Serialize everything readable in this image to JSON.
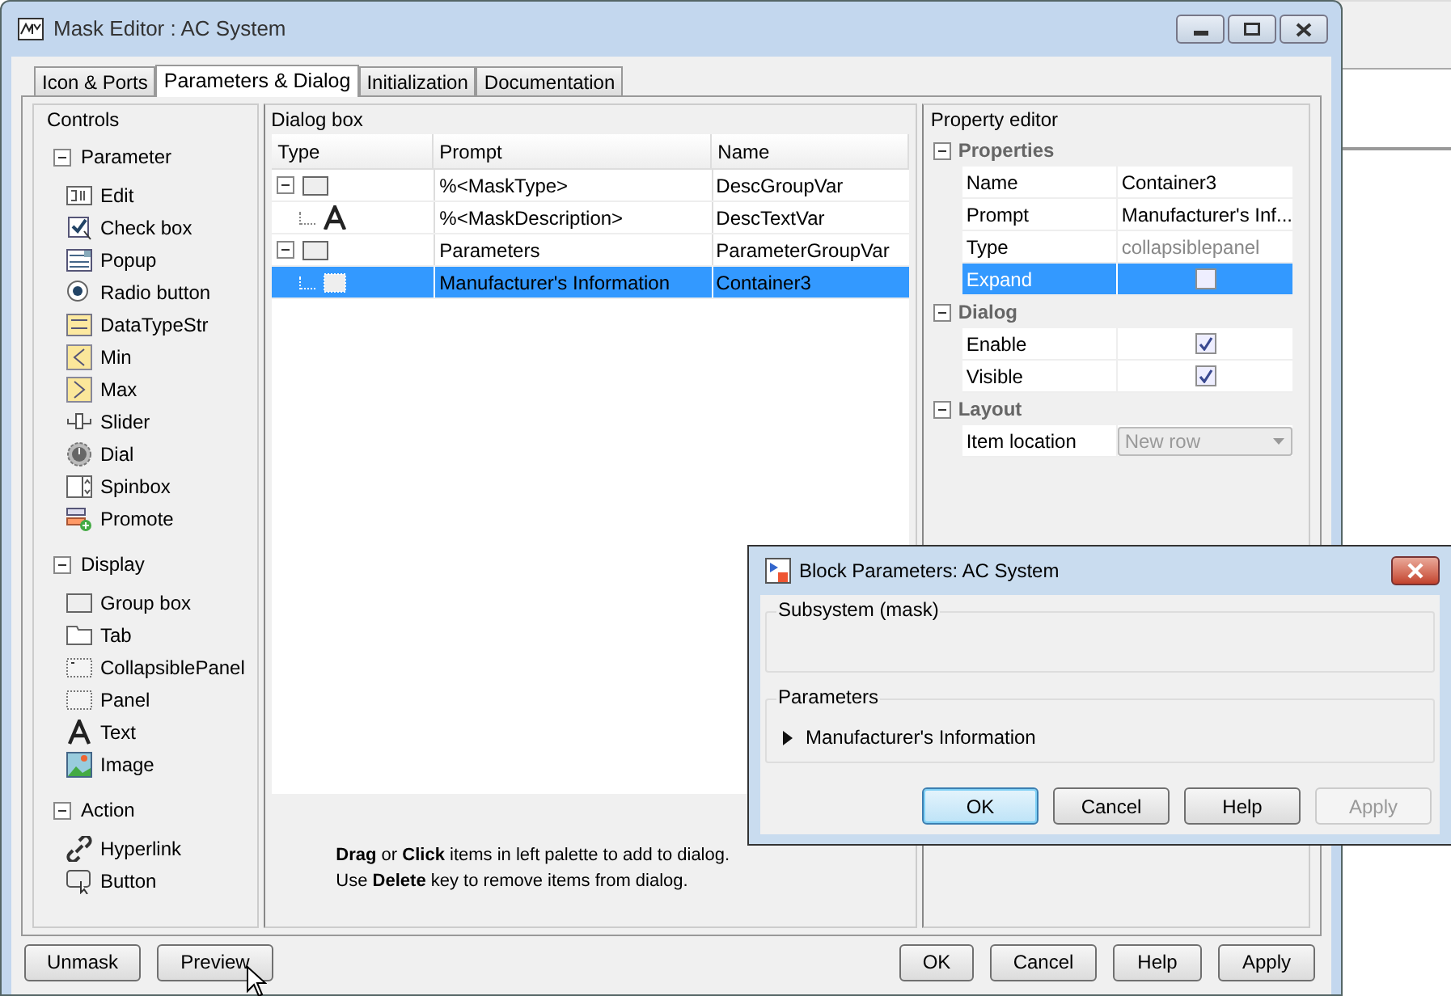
{
  "window": {
    "title": "Mask Editor : AC System"
  },
  "tabs": [
    {
      "label": "Icon & Ports",
      "selected": false
    },
    {
      "label": "Parameters & Dialog",
      "selected": true
    },
    {
      "label": "Initialization",
      "selected": false
    },
    {
      "label": "Documentation",
      "selected": false
    }
  ],
  "controls_palette": {
    "title": "Controls",
    "sections": [
      {
        "label": "Parameter",
        "expanded": true,
        "items": [
          {
            "label": "Edit",
            "kind": "edit"
          },
          {
            "label": "Check box",
            "kind": "checkbox"
          },
          {
            "label": "Popup",
            "kind": "popup"
          },
          {
            "label": "Radio button",
            "kind": "radio"
          },
          {
            "label": "DataTypeStr",
            "kind": "datatype"
          },
          {
            "label": "Min",
            "kind": "min"
          },
          {
            "label": "Max",
            "kind": "max"
          },
          {
            "label": "Slider",
            "kind": "slider"
          },
          {
            "label": "Dial",
            "kind": "dial"
          },
          {
            "label": "Spinbox",
            "kind": "spinbox"
          },
          {
            "label": "Promote",
            "kind": "promote"
          }
        ]
      },
      {
        "label": "Display",
        "expanded": true,
        "items": [
          {
            "label": "Group box",
            "kind": "groupbox"
          },
          {
            "label": "Tab",
            "kind": "tab"
          },
          {
            "label": "CollapsiblePanel",
            "kind": "collapsible"
          },
          {
            "label": "Panel",
            "kind": "panel"
          },
          {
            "label": "Text",
            "kind": "text"
          },
          {
            "label": "Image",
            "kind": "image"
          }
        ]
      },
      {
        "label": "Action",
        "expanded": true,
        "items": [
          {
            "label": "Hyperlink",
            "kind": "hyperlink"
          },
          {
            "label": "Button",
            "kind": "button"
          }
        ]
      }
    ]
  },
  "dialog_box": {
    "title": "Dialog box",
    "columns": [
      "Type",
      "Prompt",
      "Name"
    ],
    "rows": [
      {
        "kind": "group",
        "expanded": true,
        "prompt": "%<MaskType>",
        "name": "DescGroupVar",
        "selected": false,
        "children": [
          {
            "kind": "text",
            "prompt": "%<MaskDescription>",
            "name": "DescTextVar",
            "selected": false
          }
        ]
      },
      {
        "kind": "group",
        "expanded": true,
        "prompt": "Parameters",
        "name": "ParameterGroupVar",
        "selected": false,
        "children": [
          {
            "kind": "collapsible",
            "prompt": "Manufacturer's Information",
            "name": "Container3",
            "selected": true
          }
        ]
      }
    ],
    "hint_lines": [
      "**Drag** or **Click** items in left palette to add to dialog.",
      "Use **Delete** key to remove items from dialog."
    ]
  },
  "property_editor": {
    "title": "Property editor",
    "sections": [
      {
        "label": "Properties",
        "expanded": true,
        "rows": [
          {
            "kind": "text",
            "label": "Name",
            "value": "Container3",
            "disabled": false,
            "selected": false
          },
          {
            "kind": "text",
            "label": "Prompt",
            "value": "Manufacturer's Inf...",
            "disabled": false,
            "selected": false
          },
          {
            "kind": "text",
            "label": "Type",
            "value": "collapsiblepanel",
            "disabled": true,
            "selected": false
          },
          {
            "kind": "checkbox",
            "label": "Expand",
            "checked": false,
            "selected": true
          }
        ]
      },
      {
        "label": "Dialog",
        "expanded": true,
        "rows": [
          {
            "kind": "checkbox",
            "label": "Enable",
            "checked": true,
            "selected": false
          },
          {
            "kind": "checkbox",
            "label": "Visible",
            "checked": true,
            "selected": false
          }
        ]
      },
      {
        "label": "Layout",
        "expanded": true,
        "rows": [
          {
            "kind": "dropdown",
            "label": "Item location",
            "value": "New row",
            "disabled": true,
            "selected": false
          }
        ]
      }
    ]
  },
  "bottom_buttons_left": [
    "Unmask",
    "Preview"
  ],
  "bottom_buttons_right": [
    "OK",
    "Cancel",
    "Help",
    "Apply"
  ],
  "block_parameters": {
    "title": "Block Parameters: AC System",
    "subsystem_label": "Subsystem (mask)",
    "parameters_label": "Parameters",
    "panel": {
      "label": "Manufacturer's Information",
      "expanded": false
    },
    "buttons": [
      {
        "label": "OK",
        "default": true,
        "disabled": false
      },
      {
        "label": "Cancel",
        "default": false,
        "disabled": false
      },
      {
        "label": "Help",
        "default": false,
        "disabled": false
      },
      {
        "label": "Apply",
        "default": false,
        "disabled": true
      }
    ]
  }
}
